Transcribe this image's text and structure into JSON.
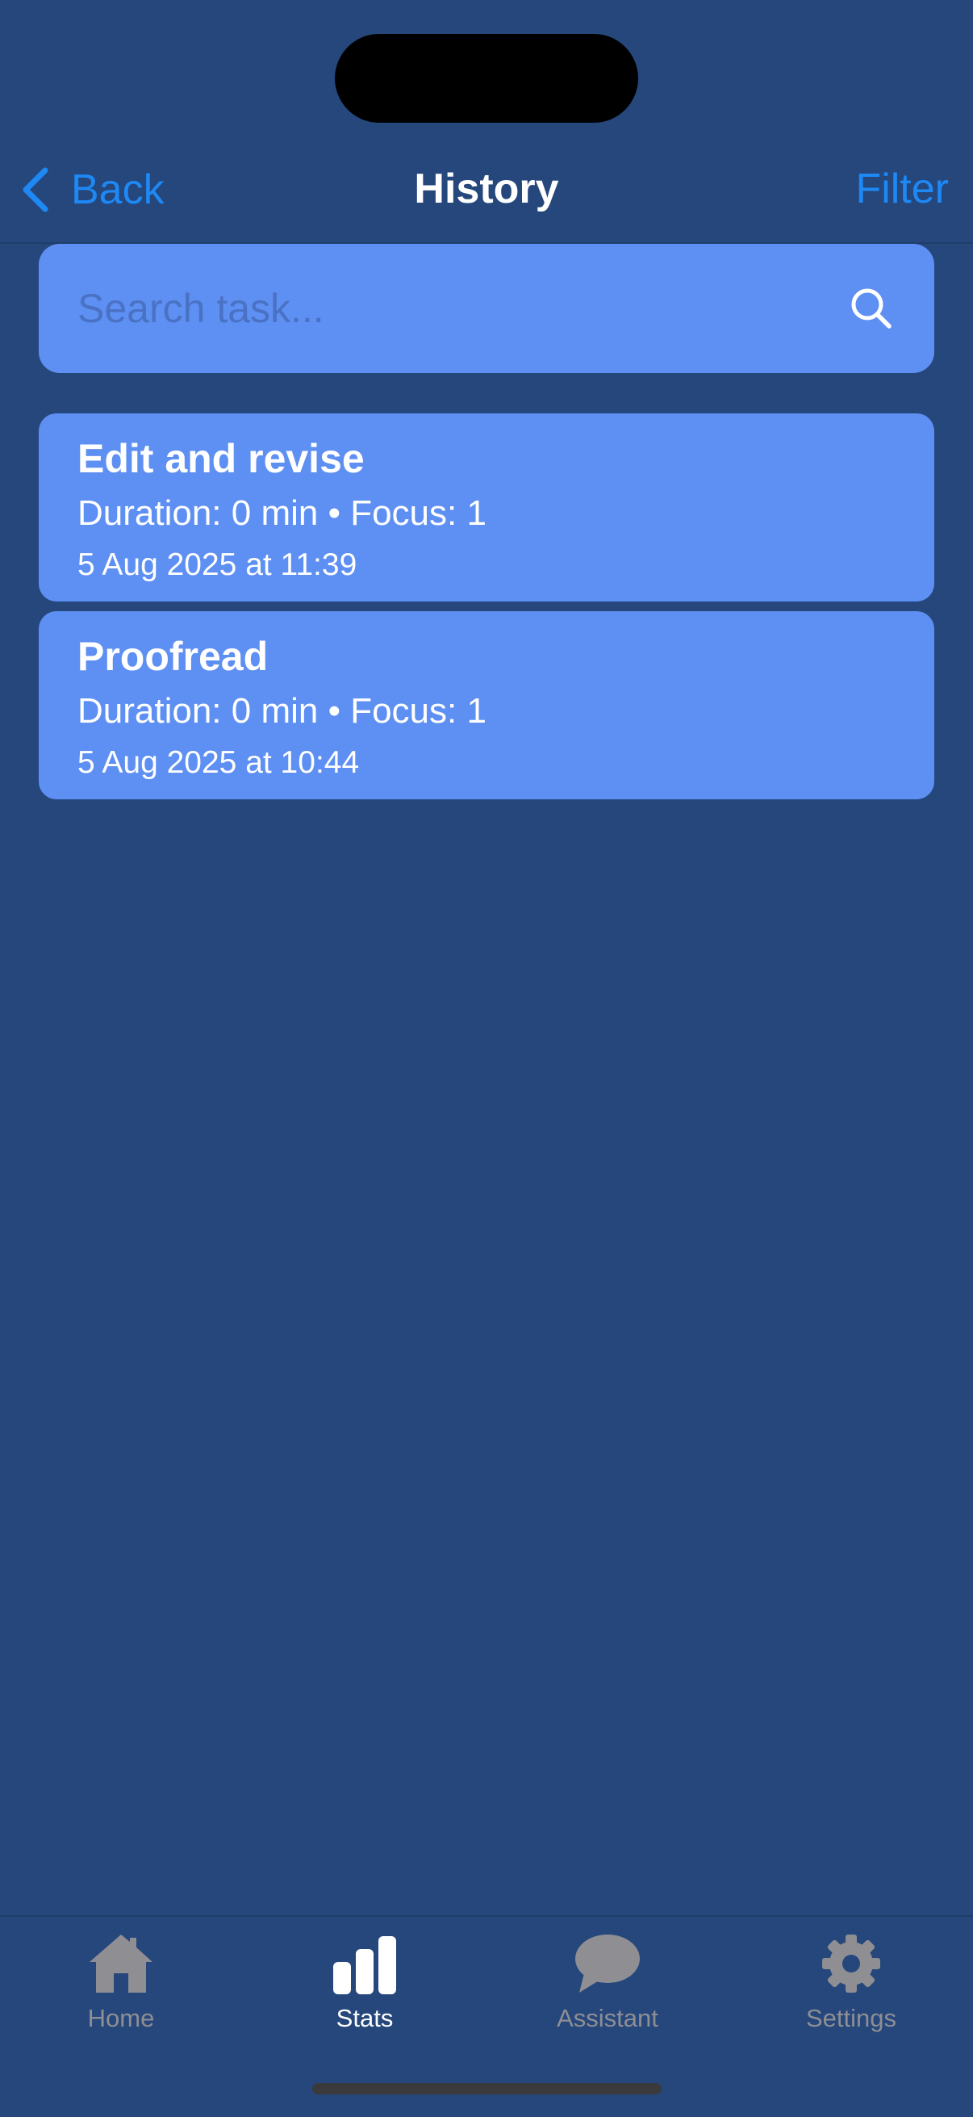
{
  "navbar": {
    "back_label": "Back",
    "title": "History",
    "filter_label": "Filter"
  },
  "search": {
    "value": "",
    "placeholder": "Search task..."
  },
  "tasks": [
    {
      "title": "Edit and revise",
      "meta": "Duration: 0 min • Focus: 1",
      "date": "5 Aug 2025 at 11:39"
    },
    {
      "title": "Proofread",
      "meta": "Duration: 0 min • Focus: 1",
      "date": "5 Aug 2025 at 10:44"
    }
  ],
  "tabbar": {
    "items": [
      {
        "label": "Home",
        "icon": "house-icon",
        "active": false
      },
      {
        "label": "Stats",
        "icon": "bar-chart-icon",
        "active": true
      },
      {
        "label": "Assistant",
        "icon": "speech-bubble-icon",
        "active": false
      },
      {
        "label": "Settings",
        "icon": "gear-icon",
        "active": false
      }
    ]
  },
  "colors": {
    "background": "#25477c",
    "card": "#5e8ff2",
    "accent": "#1e88f5",
    "tab_inactive": "#8e8e93",
    "tab_active": "#ffffff"
  }
}
